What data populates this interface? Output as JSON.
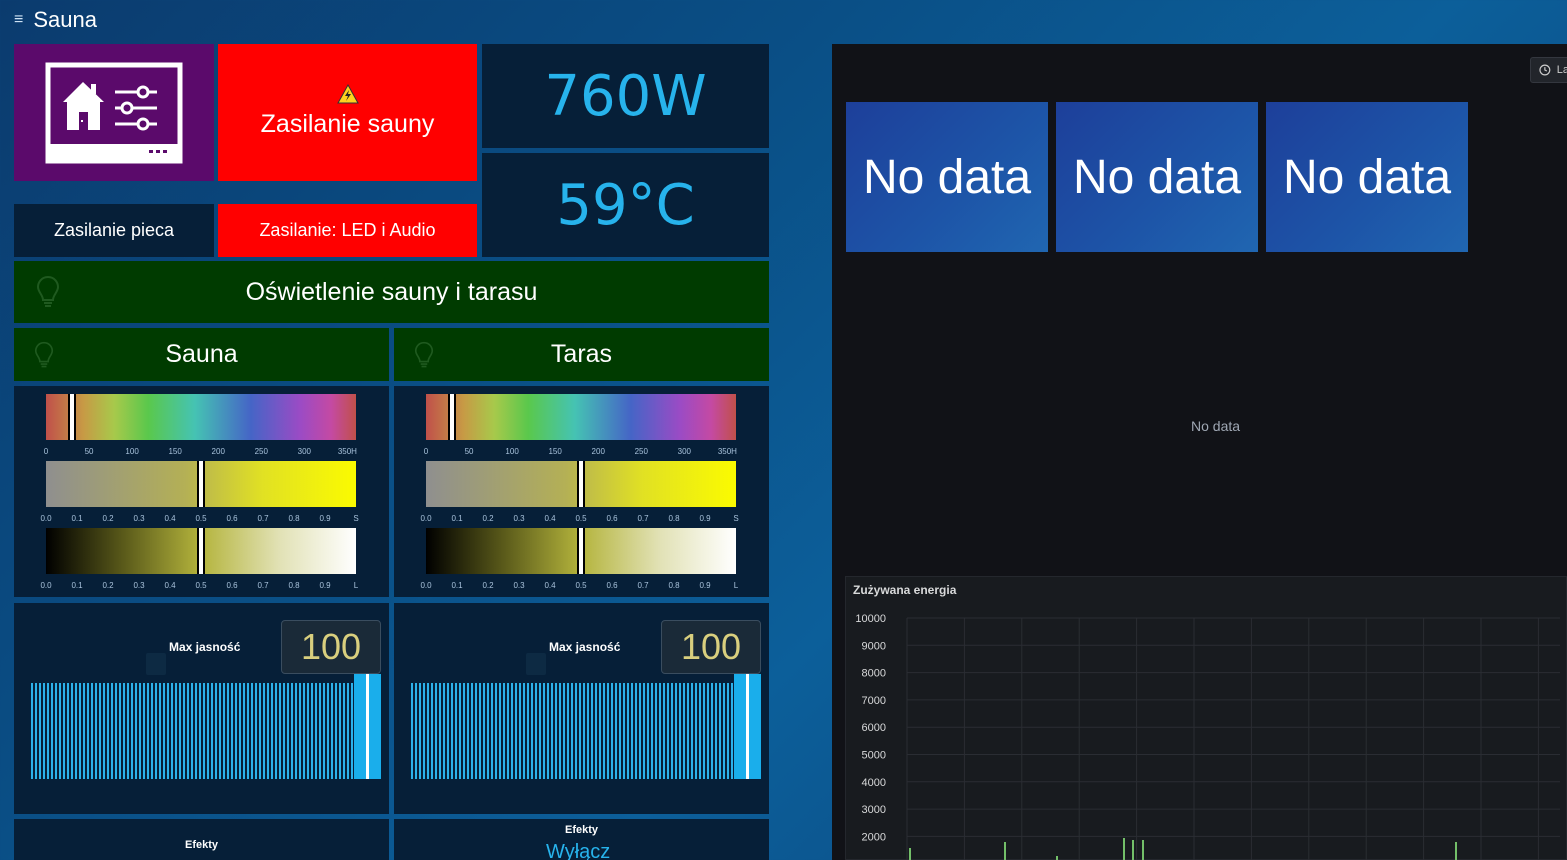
{
  "header": {
    "title": "Sauna",
    "menu_icon": "≡"
  },
  "tiles": {
    "logo_icon": "home-settings-icon",
    "sauna_power_label": "Zasilanie sauny",
    "power_value": "760W",
    "temp_value": "59°C",
    "oven_power_label": "Zasilanie pieca",
    "led_audio_label": "Zasilanie: LED i Audio",
    "lighting_label": "Oświetlenie sauny i tarasu",
    "sauna_label": "Sauna",
    "taras_label": "Taras"
  },
  "colors": {
    "accent": "#27b3ec",
    "red": "#ff0000",
    "green": "#003b00",
    "dark": "#061f38"
  },
  "scales": {
    "hue": [
      "0",
      "50",
      "100",
      "150",
      "200",
      "250",
      "300",
      "350H"
    ],
    "sat": [
      "0.0",
      "0.1",
      "0.2",
      "0.3",
      "0.4",
      "0.5",
      "0.6",
      "0.7",
      "0.8",
      "0.9",
      "S"
    ],
    "light": [
      "0.0",
      "0.1",
      "0.2",
      "0.3",
      "0.4",
      "0.5",
      "0.6",
      "0.7",
      "0.8",
      "0.9",
      "L"
    ]
  },
  "sauna_controls": {
    "hue": 30,
    "sat": 0.5,
    "light": 0.5,
    "max_label": "Max jasność",
    "max_value": "100",
    "effects_label": "Efekty"
  },
  "taras_controls": {
    "hue": 30,
    "sat": 0.5,
    "light": 0.5,
    "max_label": "Max jasność",
    "max_value": "100",
    "effects_label": "Efekty",
    "effects_value": "Wyłącz"
  },
  "grafana": {
    "time_label": "La",
    "stat1": "No data",
    "stat2": "No data",
    "stat3": "No data",
    "center_nodata": "No data",
    "chart_title": "Zużywana energia"
  },
  "chart_data": {
    "type": "line",
    "title": "Zużywana energia",
    "xlabel": "",
    "ylabel": "",
    "ylim": [
      0,
      10000
    ],
    "y_ticks": [
      "10000",
      "9000",
      "8000",
      "7000",
      "6000",
      "5000",
      "4000",
      "3000",
      "2000"
    ],
    "grid": true
  }
}
